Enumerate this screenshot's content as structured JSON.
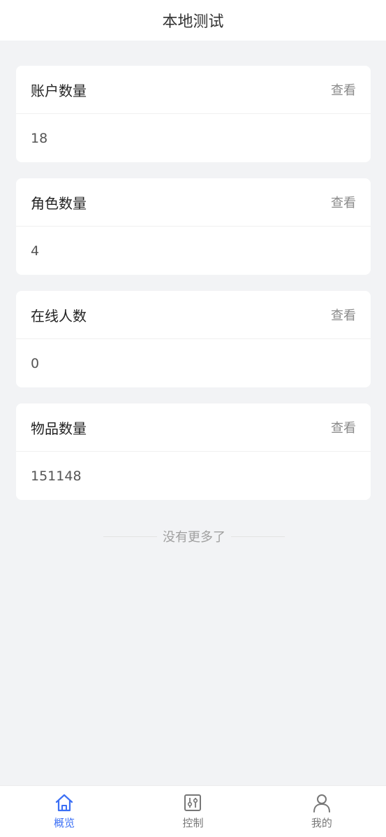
{
  "header": {
    "title": "本地测试"
  },
  "cards": [
    {
      "title": "账户数量",
      "link": "查看",
      "value": "18"
    },
    {
      "title": "角色数量",
      "link": "查看",
      "value": "4"
    },
    {
      "title": "在线人数",
      "link": "查看",
      "value": "0"
    },
    {
      "title": "物品数量",
      "link": "查看",
      "value": "151148"
    }
  ],
  "list_end": {
    "text": "没有更多了"
  },
  "tabbar": {
    "active_color": "#3b6ff5",
    "inactive_color": "#777777",
    "items": [
      {
        "label": "概览",
        "icon": "home-icon",
        "active": true
      },
      {
        "label": "控制",
        "icon": "sliders-icon",
        "active": false
      },
      {
        "label": "我的",
        "icon": "user-icon",
        "active": false
      }
    ]
  }
}
